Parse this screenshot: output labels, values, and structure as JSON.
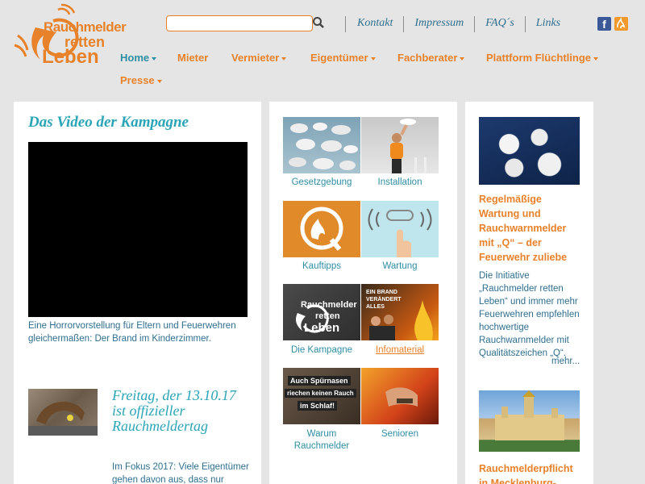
{
  "header": {
    "logo": {
      "line1": "Rauchmelder",
      "line2": "retten",
      "line3": "Leben"
    },
    "search": {
      "placeholder": ""
    },
    "top_links": [
      "Kontakt",
      "Impressum",
      "FAQ´s",
      "Links"
    ],
    "social": {
      "facebook": "f"
    }
  },
  "nav": {
    "items": [
      {
        "label": "Home",
        "active": true
      },
      {
        "label": "Mieter"
      },
      {
        "label": "Vermieter"
      },
      {
        "label": "Eigentümer"
      },
      {
        "label": "Fachberater"
      },
      {
        "label": "Plattform Flüchtlinge"
      },
      {
        "label": "Presse"
      }
    ]
  },
  "left": {
    "video_heading": "Das Video der Kampagne",
    "video_caption": "Eine Horrorvorstellung für Eltern und Feuerwehren gleichermaßen: Der Brand im Kinderzimmer.",
    "news_title": "Freitag, der 13.10.17 ist offizieller Rauchmeldertag",
    "news_text": "Im Fokus 2017: Viele Eigentümer gehen davon aus, dass nur"
  },
  "tiles": [
    {
      "label": "Gesetzgebung"
    },
    {
      "label": "Installation"
    },
    {
      "label": "Kauftipps"
    },
    {
      "label": "Wartung"
    },
    {
      "label": "Die Kampagne"
    },
    {
      "label": "Infomaterial"
    },
    {
      "label": "Warum Rauchmelder"
    },
    {
      "label": "Senioren"
    }
  ],
  "tile_texts": {
    "kampagne_logo": [
      "Rauchmelder",
      "retten",
      "Leben"
    ],
    "brand": [
      "EIN BRAND",
      "VERÄNDERT",
      "ALLES"
    ],
    "spuernasen": [
      "Auch Spürnasen",
      "riechen keinen Rauch",
      "im Schlaf!"
    ]
  },
  "right": {
    "title1": "Regelmäßige Wartung und Rauchwarnmelder mit „Q“ – der Feuerwehr zuliebe",
    "text1": "Die Initiative „Rauchmelder retten Leben“ und immer mehr Feuerwehren empfehlen hochwertige Rauchwarnmelder mit Qualitätszeichen „Q“.",
    "more": "mehr...",
    "title2": "Rauchmelderpflicht in Mecklenburg-"
  },
  "colors": {
    "orange": "#e8822a",
    "teal": "#2aa5b7",
    "blue": "#2e6f8e"
  }
}
